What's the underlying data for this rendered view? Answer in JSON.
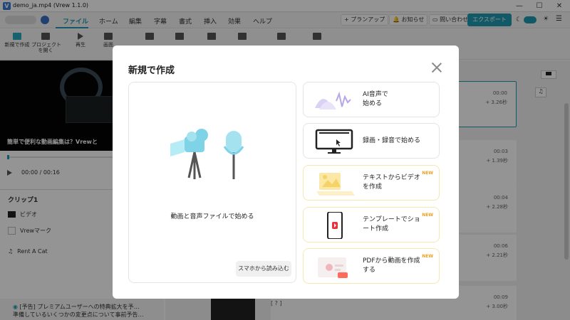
{
  "window": {
    "title": "demo_ja.mp4 (Vrew 1.1.0)",
    "logo": "V",
    "minimize": "—",
    "maximize": "☐",
    "close": "✕"
  },
  "menu": {
    "tabs": [
      "ファイル",
      "ホーム",
      "編集",
      "字幕",
      "書式",
      "挿入",
      "効果",
      "ヘルプ"
    ],
    "plan": "プランアップ",
    "notice": "お知らせ",
    "contact": "問い合わせ",
    "export": "エクスポート"
  },
  "toolbar": {
    "items": [
      "新規で作成",
      "プロジェクト\nを開く",
      "再生",
      "画面"
    ]
  },
  "player": {
    "caption": "簡単で便利な動画編集は？Vrewと",
    "time": "00:00 / 00:16"
  },
  "clips": {
    "header": "クリップ1",
    "items": [
      "ビデオ",
      "Vrewマーク",
      "Rent A Cat"
    ]
  },
  "notice": {
    "line1": "[予告] プレミアムユーザーへの特典拡大を予…",
    "line2": "準備しているいくつかの変更点について事前予告…"
  },
  "timeline": {
    "rows": [
      {
        "t": "00:00",
        "d": "+ 3.26秒"
      },
      {
        "t": "00:03",
        "d": "+ 1.39秒"
      },
      {
        "t": "00:04",
        "d": "+ 2.28秒"
      },
      {
        "t": "00:06",
        "d": "+ 2.21秒"
      },
      {
        "t": "00:09",
        "d": "+ 3.00秒"
      }
    ],
    "bracket": "[ ? ]"
  },
  "modal": {
    "title": "新規で作成",
    "main_label": "動画と音声ファイルで始める",
    "smartphone_btn": "スマホから読み込む",
    "options": [
      {
        "label": "AI音声で\n始める",
        "new": ""
      },
      {
        "label": "録画・録音で始める",
        "new": ""
      },
      {
        "label": "テキストからビデオ\nを作成",
        "new": "NEW"
      },
      {
        "label": "テンプレートでショ\nート作成",
        "new": "NEW"
      },
      {
        "label": "PDFから動画を作成\nする",
        "new": "NEW"
      }
    ]
  },
  "colors": {
    "accent": "#1e9ab0",
    "new_badge": "#f0a020"
  }
}
